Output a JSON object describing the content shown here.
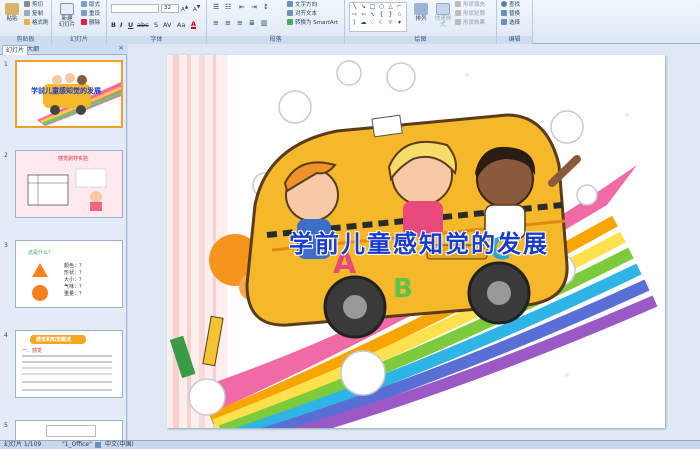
{
  "ribbon": {
    "groups": {
      "clipboard": "剪贴板",
      "slides": "幻灯片",
      "font": "字体",
      "paragraph": "段落",
      "drawing": "绘图",
      "editing": "编辑"
    },
    "paste": "粘贴",
    "cut": "剪切",
    "copy": "复制",
    "format_painter": "格式刷",
    "new_slide": "新建\n幻灯片",
    "layout": "版式",
    "reset": "重设",
    "delete": "删除",
    "font_name": "",
    "font_size": "32",
    "text_direction": "文字方向",
    "align_text": "对齐文本",
    "smartart": "转换为 SmartArt",
    "arrange": "排列",
    "quick_styles": "快速样式",
    "shape_fill": "形状填充",
    "shape_outline": "形状轮廓",
    "shape_effects": "形状效果",
    "find": "查找",
    "replace": "替换",
    "select": "选择"
  },
  "pane": {
    "tab_slides": "幻灯片",
    "tab_outline": "大纲",
    "close": "×",
    "thumbs": [
      {
        "num": "1",
        "title": "学前儿童感知觉的发展"
      },
      {
        "num": "2",
        "title": "感觉剥夺实验"
      },
      {
        "num": "3",
        "title": "这是什么？",
        "lines": [
          "颜色：？",
          "形状：？",
          "大小：？",
          "气味：？",
          "重量：？"
        ]
      },
      {
        "num": "4",
        "title": "感觉和知觉概述",
        "sub": "一、感觉"
      },
      {
        "num": "5"
      }
    ]
  },
  "slide": {
    "title": "学前儿童感知觉的发展"
  },
  "status": {
    "slide_count": "幻灯片 1/109",
    "theme": "\"1_Office\"",
    "language": "中文(中国)"
  },
  "colors": {
    "title_blue": "#1a3ccc",
    "bus_yellow": "#f5b82a",
    "selected_border": "#f0a030"
  }
}
